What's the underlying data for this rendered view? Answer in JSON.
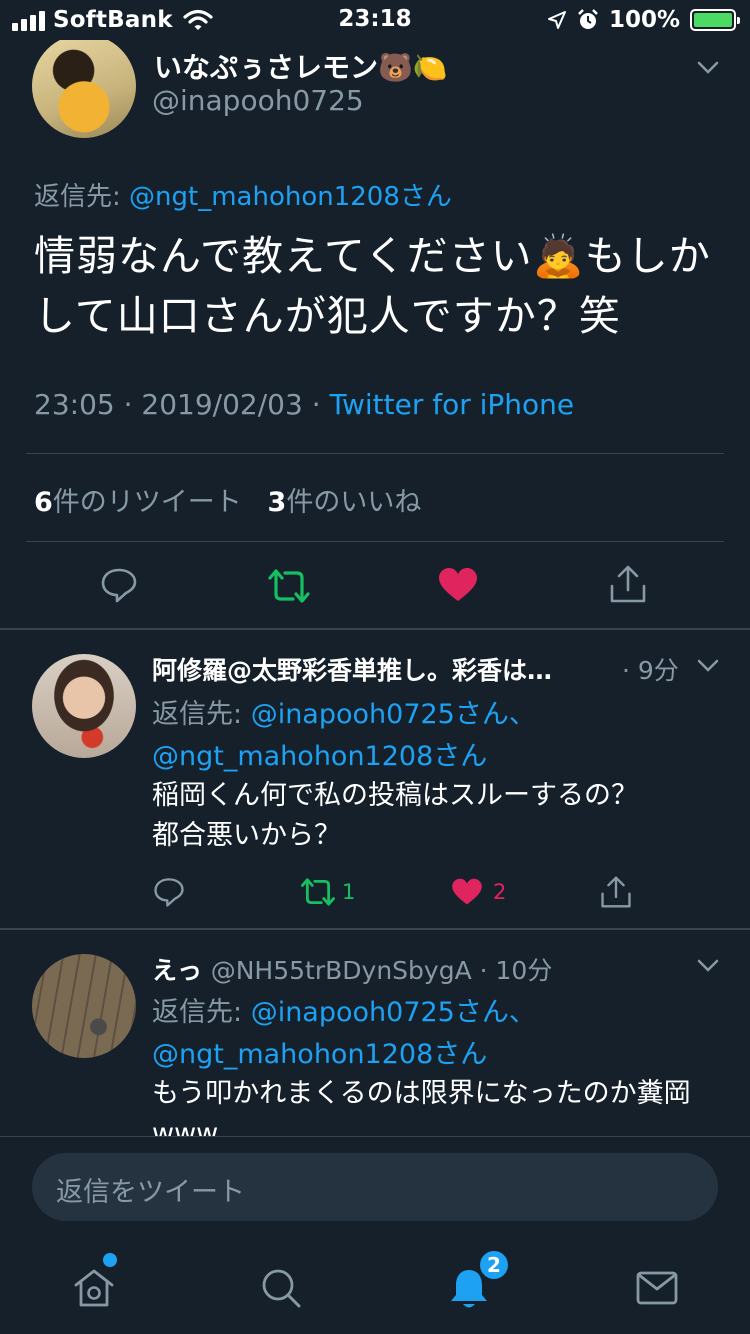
{
  "status_bar": {
    "carrier": "SoftBank",
    "time": "23:18",
    "battery": "100%"
  },
  "tweet": {
    "name": "いなぷぅさレモン🐻🍋",
    "handle": "@inapooh0725",
    "reply_prefix": "返信先: ",
    "reply_to": "@ngt_mahohon1208さん",
    "text": "情弱なんで教えてください🙇もしかして山口さんが犯人ですか？笑",
    "time": "23:05",
    "date": "2019/02/03",
    "source": "Twitter for iPhone",
    "retweet_count": "6",
    "retweet_label": "件のリツイート",
    "like_count": "3",
    "like_label": "件のいいね"
  },
  "replies": [
    {
      "name": "阿修羅@太野彩香単推し。彩香は…",
      "time": "9分",
      "reply_prefix": "返信先: ",
      "reply_to_1": "@inapooh0725さん、",
      "reply_to_2": "@ngt_mahohon1208さん",
      "text_1": "稲岡くん何で私の投稿はスルーするの？",
      "text_2": "都合悪いから？",
      "retweets": "1",
      "likes": "2"
    },
    {
      "name": "えっ",
      "handle": "@NH55trBDynSbygA",
      "time": "10分",
      "reply_prefix": "返信先: ",
      "reply_to_1": "@inapooh0725さん、",
      "reply_to_2": "@ngt_mahohon1208さん",
      "text_1": "もう叩かれまくるのは限界になったのか糞岡",
      "text_2": "www"
    }
  ],
  "composer": {
    "placeholder": "返信をツイート"
  },
  "tab_bar": {
    "notifications_badge": "2"
  },
  "colors": {
    "background": "#15202b",
    "link": "#1da1f2",
    "retweet": "#17bf63",
    "like": "#e0245e",
    "muted": "#8899a6",
    "divider": "#38444d"
  },
  "icons": [
    "signal-icon",
    "wifi-icon",
    "location-icon",
    "alarm-icon",
    "battery-icon",
    "chevron-down-icon",
    "reply-icon",
    "retweet-icon",
    "like-icon",
    "share-icon",
    "home-icon",
    "search-icon",
    "notifications-icon",
    "messages-icon"
  ]
}
